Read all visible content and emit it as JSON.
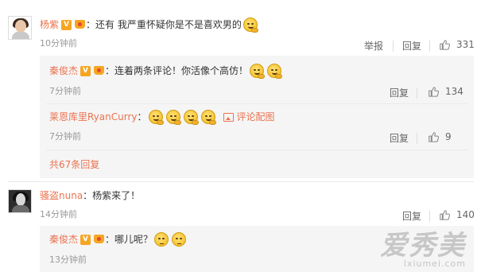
{
  "comments": [
    {
      "user": "杨紫",
      "text": "：还有 我严重怀疑你是不是喜欢男的",
      "time": "10分钟前",
      "report": "举报",
      "reply": "回复",
      "likes": "331",
      "replies": [
        {
          "user": "秦俊杰",
          "text": "：连着两条评论！你活像个高仿！",
          "time": "7分钟前",
          "reply": "回复",
          "likes": "134"
        },
        {
          "user": "莱恩库里RyanCurry",
          "text": "：",
          "comment_image": "评论配图",
          "time": "7分钟前",
          "reply": "回复",
          "likes": "9"
        }
      ],
      "more_replies": "共67条回复"
    },
    {
      "user": "骚盗nuna",
      "text": "：杨紫来了！",
      "time": "14分钟前",
      "reply": "回复",
      "likes": "140",
      "replies": [
        {
          "user": "秦俊杰",
          "text": "：哪儿呢？",
          "time": "13分钟前"
        }
      ]
    }
  ],
  "watermark": {
    "title": "爱秀美",
    "url": "lxiumei.com"
  },
  "icons": {
    "like": "thumbs-up-icon",
    "verified": "verified-v-icon",
    "vip": "vip-crown-icon",
    "emoji": "emoji-icon",
    "image": "image-icon"
  },
  "colors": {
    "username": "#eb7350",
    "text": "#333333",
    "time": "#999999",
    "reply_bg": "#f5f5f5",
    "badge": "#f6a623"
  }
}
